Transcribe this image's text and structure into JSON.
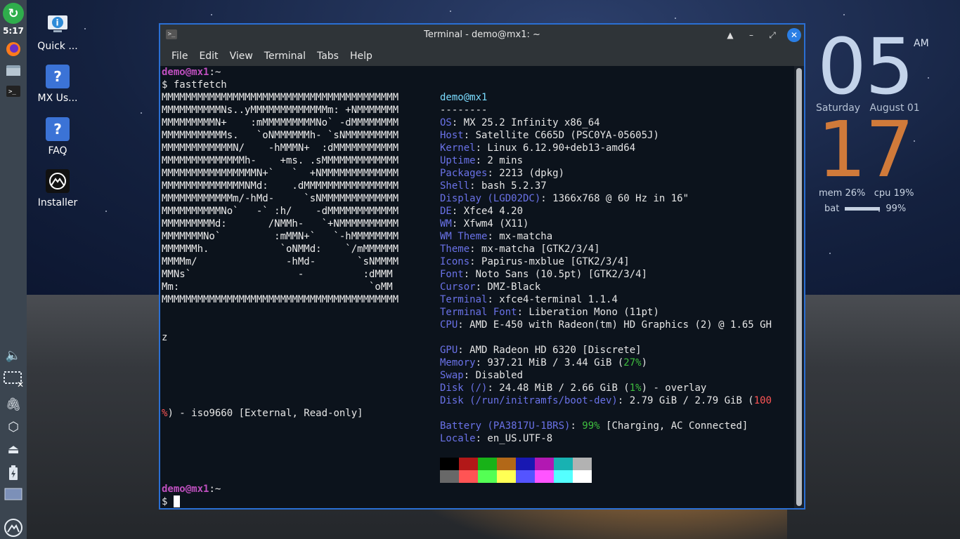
{
  "panel": {
    "time": "5:17",
    "icons": [
      "mx-updater-icon",
      "firefox-icon",
      "file-manager-icon",
      "terminal-icon",
      "volume-icon",
      "network-disconnected-icon",
      "clipboard-icon",
      "package-icon",
      "eject-icon",
      "battery-icon",
      "workspace-icon",
      "mx-menu-icon"
    ]
  },
  "desktop": {
    "icons": [
      {
        "label": "Quick ...",
        "glyph": "i"
      },
      {
        "label": "MX Us...",
        "glyph": "?"
      },
      {
        "label": "FAQ",
        "glyph": "?"
      },
      {
        "label": "Installer",
        "glyph": "▲"
      }
    ]
  },
  "conky": {
    "hour": "05",
    "ampm": "AM",
    "day": "Saturday",
    "date": "August 01",
    "minute": "17",
    "mem_label": "mem",
    "mem_value": "26%",
    "cpu_label": "cpu",
    "cpu_value": "19%",
    "bat_label": "bat",
    "bat_value": "99%",
    "bat_fraction": 0.99
  },
  "window": {
    "title": "Terminal - demo@mx1: ~",
    "menu": [
      "File",
      "Edit",
      "View",
      "Terminal",
      "Tabs",
      "Help"
    ]
  },
  "terminal": {
    "prompt_user": "demo@mx1",
    "prompt_sep": ":~",
    "prompt_sym": "$",
    "command": "fastfetch",
    "logo": [
      "MMMMMMMMMMMMMMMMMMMMMMMMMMMMMMMMMMMMMMMM",
      "MMMMMMMMMMNs..yMMMMMMMMMMMMMm: +NMMMMMMM",
      "MMMMMMMMMN+    :mMMMMMMMMMNo` -dMMMMMMMM",
      "MMMMMMMMMMMs.   `oNMMMMMMh- `sNMMMMMMMMM",
      "MMMMMMMMMMMMN/    -hMMMN+  :dMMMMMMMMMMM",
      "MMMMMMMMMMMMMMh-    +ms. .sMMMMMMMMMMMMM",
      "MMMMMMMMMMMMMMMMN+`   `  +NMMMMMMMMMMMMM",
      "MMMMMMMMMMMMMMNMd:    .dMMMMMMMMMMMMMMMM",
      "MMMMMMMMMMMMm/-hMd-     `sNMMMMMMMMMMMMM",
      "MMMMMMMMMMNo`   -` :h/    -dMMMMMMMMMMMM",
      "MMMMMMMMMd:       /NMMh-   `+NMMMMMMMMMM",
      "MMMMMMMNo`         :mMMN+`   `-hMMMMMMMM",
      "MMMMMMh.            `oNMMd:    `/mMMMMMM",
      "MMMMm/               -hMd-       `sNMMMM",
      "MMNs`                  -          :dMMM",
      "Mm:                                `oMM",
      "MMMMMMMMMMMMMMMMMMMMMMMMMMMMMMMMMMMMMMMM"
    ],
    "info_title": "demo@mx1",
    "info_rule": "--------",
    "info": [
      {
        "k": "OS",
        "v": ": MX 25.2 Infinity x86_64"
      },
      {
        "k": "Host",
        "v": ": Satellite C665D (PSC0YA-05605J)"
      },
      {
        "k": "Kernel",
        "v": ": Linux 6.12.90+deb13-amd64"
      },
      {
        "k": "Uptime",
        "v": ": 2 mins"
      },
      {
        "k": "Packages",
        "v": ": 2213 (dpkg)"
      },
      {
        "k": "Shell",
        "v": ": bash 5.2.37"
      },
      {
        "k": "Display (LGD02DC)",
        "v": ": 1366x768 @ 60 Hz in 16\""
      },
      {
        "k": "DE",
        "v": ": Xfce4 4.20"
      },
      {
        "k": "WM",
        "v": ": Xfwm4 (X11)"
      },
      {
        "k": "WM Theme",
        "v": ": mx-matcha"
      },
      {
        "k": "Theme",
        "v": ": mx-matcha [GTK2/3/4]"
      },
      {
        "k": "Icons",
        "v": ": Papirus-mxblue [GTK2/3/4]"
      },
      {
        "k": "Font",
        "v": ": Noto Sans (10.5pt) [GTK2/3/4]"
      },
      {
        "k": "Cursor",
        "v": ": DMZ-Black"
      },
      {
        "k": "Terminal",
        "v": ": xfce4-terminal 1.1.4"
      },
      {
        "k": "Terminal Font",
        "v": ": Liberation Mono (11pt)"
      },
      {
        "k": "CPU",
        "v": ": AMD E-450 with Radeon(tm) HD Graphics (2) @ 1.65 GH"
      }
    ],
    "cpu_wrap": "z",
    "gpu": {
      "k": "GPU",
      "v": ": AMD Radeon HD 6320 [Discrete]"
    },
    "memory": {
      "k": "Memory",
      "v1": ": 937.21 MiB / 3.44 GiB (",
      "pct": "27%",
      "v2": ")"
    },
    "swap": {
      "k": "Swap",
      "v": ": Disabled"
    },
    "disk1": {
      "k": "Disk (/)",
      "v1": ": 24.48 MiB / 2.66 GiB (",
      "pct": "1%",
      "v2": ") - overlay"
    },
    "disk2": {
      "k": "Disk (/run/initramfs/boot-dev)",
      "v1": ": 2.79 GiB / 2.79 GiB (",
      "pct": "100"
    },
    "disk2_wrap_pct": "%",
    "disk2_wrap": ") - iso9660 [External, Read-only]",
    "battery": {
      "k": "Battery (PA3817U-1BRS)",
      "v1": ": ",
      "pct": "99%",
      "v2": " [Charging, AC Connected]"
    },
    "locale": {
      "k": "Locale",
      "v": ": en_US.UTF-8"
    },
    "colors_top": [
      "#000000",
      "#b21818",
      "#18b218",
      "#b26818",
      "#1818b2",
      "#b218b2",
      "#18b2b2",
      "#b2b2b2"
    ],
    "colors_bottom": [
      "#686868",
      "#ff5454",
      "#54ff54",
      "#ffff54",
      "#5454ff",
      "#ff54ff",
      "#54ffff",
      "#ffffff"
    ]
  }
}
